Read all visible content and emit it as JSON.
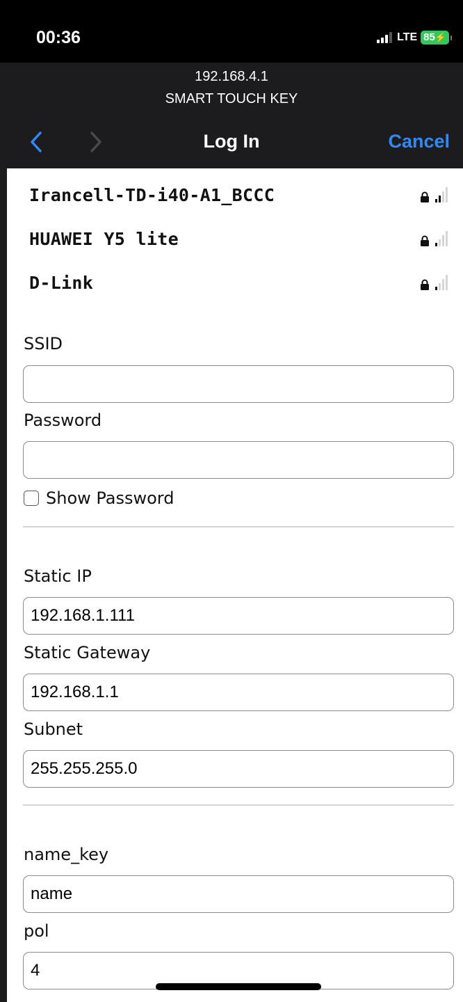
{
  "status_bar": {
    "time": "00:36",
    "network": "LTE",
    "battery": "85",
    "battery_color": "#34c759"
  },
  "login_sheet": {
    "host": "192.168.4.1",
    "realm": "SMART TOUCH KEY",
    "title": "Log In",
    "cancel_label": "Cancel",
    "back_icon": "chevron-left-icon",
    "forward_icon": "chevron-right-icon",
    "accent_color": "#2f8af5"
  },
  "networks": [
    {
      "name": "Irancell-TD-i40-A1_BCCC",
      "secured": true,
      "signal_bars": 2,
      "max_bars": 4
    },
    {
      "name": "HUAWEI Y5 lite",
      "secured": true,
      "signal_bars": 1,
      "max_bars": 4
    },
    {
      "name": "D-Link",
      "secured": true,
      "signal_bars": 1,
      "max_bars": 4
    }
  ],
  "wifi_form": {
    "ssid_label": "SSID",
    "ssid_value": "",
    "password_label": "Password",
    "password_value": "",
    "show_password_label": "Show Password",
    "show_password_checked": false
  },
  "ip_form": {
    "static_ip_label": "Static IP",
    "static_ip_value": "192.168.1.111",
    "gateway_label": "Static Gateway",
    "gateway_value": "192.168.1.1",
    "subnet_label": "Subnet",
    "subnet_value": "255.255.255.0"
  },
  "extra_form": {
    "name_key_label": "name_key",
    "name_key_value": "name",
    "pol_label": "pol",
    "pol_value": "4"
  }
}
